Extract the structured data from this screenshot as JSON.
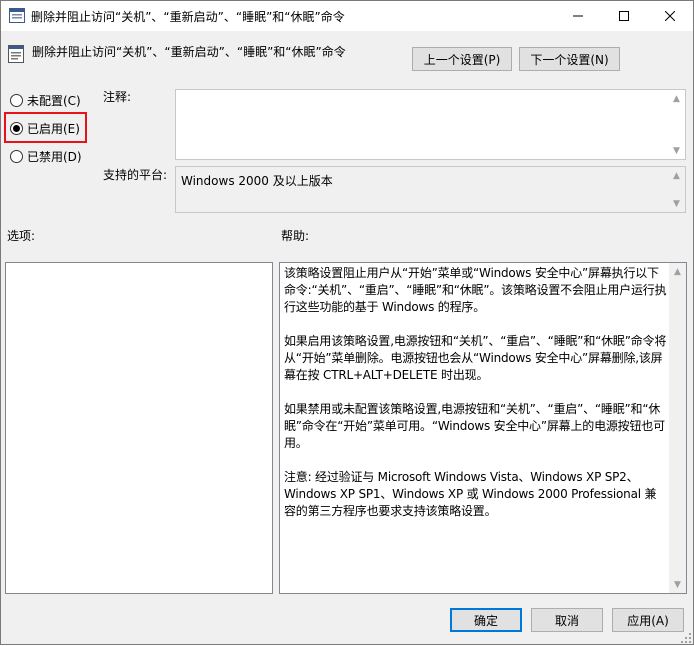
{
  "window": {
    "title": "删除并阻止访问“关机”、“重新启动”、“睡眠”和“休眠”命令"
  },
  "header": {
    "policy_name": "删除并阻止访问“关机”、“重新启动”、“睡眠”和“休眠”命令",
    "prev_button": "上一个设置(P)",
    "next_button": "下一个设置(N)"
  },
  "state": {
    "options": [
      {
        "label": "未配置(C)",
        "checked": false
      },
      {
        "label": "已启用(E)",
        "checked": true
      },
      {
        "label": "已禁用(D)",
        "checked": false
      }
    ]
  },
  "comment": {
    "label": "注释:",
    "value": ""
  },
  "platform": {
    "label": "支持的平台:",
    "value": "Windows 2000 及以上版本"
  },
  "options_section": {
    "label": "选项:"
  },
  "help_section": {
    "label": "帮助:",
    "paragraphs": [
      "该策略设置阻止用户从“开始”菜单或“Windows 安全中心”屏幕执行以下命令:“关机”、“重启”、“睡眠”和“休眠”。该策略设置不会阻止用户运行执行这些功能的基于 Windows 的程序。",
      "如果启用该策略设置,电源按钮和“关机”、“重启”、“睡眠”和“休眠”命令将从“开始”菜单删除。电源按钮也会从“Windows 安全中心”屏幕删除,该屏幕在按 CTRL+ALT+DELETE 时出现。",
      "如果禁用或未配置该策略设置,电源按钮和“关机”、“重启”、“睡眠”和“休眠”命令在“开始”菜单可用。“Windows 安全中心”屏幕上的电源按钮也可用。",
      "注意: 经过验证与 Microsoft Windows Vista、Windows XP SP2、Windows XP SP1、Windows XP 或 Windows 2000 Professional 兼容的第三方程序也要求支持该策略设置。"
    ]
  },
  "footer": {
    "ok": "确定",
    "cancel": "取消",
    "apply": "应用(A)"
  },
  "colors": {
    "highlight": "#e8121b",
    "accent": "#0078d7"
  }
}
